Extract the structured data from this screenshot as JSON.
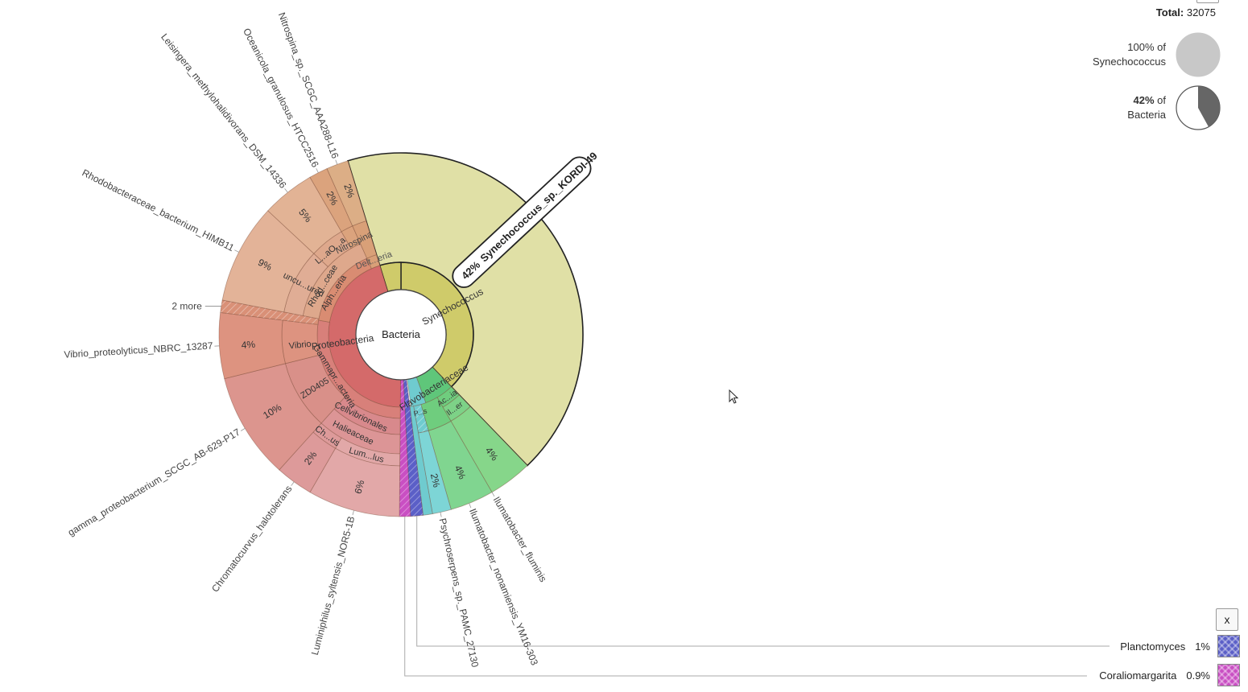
{
  "header": {
    "total_label": "Total:",
    "total_value": "32075"
  },
  "pies": [
    {
      "pct": "100%",
      "of": "of",
      "name": "Synechococcus",
      "fraction": 1.0
    },
    {
      "pct": "42%",
      "of": "of",
      "name": "Bacteria",
      "fraction": 0.42
    }
  ],
  "details_close_label": "x",
  "legend": [
    {
      "name": "Planctomyces",
      "pct": "1%",
      "color": "#5b5fc7"
    },
    {
      "name": "Coraliomargarita",
      "pct": "0.9%",
      "color": "#c94fc3"
    }
  ],
  "chart_data": {
    "type": "krona-sunburst",
    "root": "Bacteria",
    "total": 32075,
    "selected": "Synechococcus_sp._KORDI-49",
    "rank1": [
      {
        "name": "Proteobacteria",
        "label": "Proteobacteria",
        "color": "#d46a6a"
      },
      {
        "name": "Synechococcus",
        "label": "Synechococcus",
        "color": "#cfcb6a"
      },
      {
        "name": "Flavobacteriaceae",
        "label": "Flavobacteriaceae",
        "color": "#5fc67a"
      },
      {
        "name": "Planctomyces",
        "label": "",
        "color": "#5b5fc7"
      },
      {
        "name": "Coraliomargarita",
        "label": "",
        "color": "#c94fc3"
      }
    ],
    "rank2": [
      {
        "name": "Alphaproteobacteria",
        "label": "Alph...eria"
      },
      {
        "name": "Deltaproteobacteria",
        "label": "Delt...eria"
      },
      {
        "name": "Gammaproteobacteria",
        "label": "Gammapr...acteria"
      },
      {
        "name": "Acidimicrobiia",
        "label": "Ac...ia"
      },
      {
        "name": "Psychroserpens",
        "label": "P...s"
      }
    ],
    "rank3": [
      {
        "name": "Rhodobacteraceae",
        "label": "Rhod...ceae"
      },
      {
        "name": "Nitrospina",
        "label": "Nitrospina"
      },
      {
        "name": "Vibrio",
        "label": "Vibrio"
      },
      {
        "name": "ZD0405",
        "label": "ZD0405"
      },
      {
        "name": "Cellvibrionales",
        "label": "Cellvibrionales"
      },
      {
        "name": "Halieaceae",
        "label": "Halieaceae"
      },
      {
        "name": "Ilumatobacter",
        "label": "Il...er"
      }
    ],
    "rank4": [
      {
        "name": "uncultured",
        "label": "uncu...ured"
      },
      {
        "name": "L...aO...a",
        "label": "L...aO...a"
      },
      {
        "name": "Chromatocurvus",
        "label": "Ch...us"
      },
      {
        "name": "Luminiphilus",
        "label": "Lum...lus"
      }
    ],
    "species": [
      {
        "name": "Synechococcus_sp._KORDI-49",
        "pct": "42%"
      },
      {
        "name": "Ilumatobacter_fluminis",
        "pct": "4%"
      },
      {
        "name": "Ilumatobacter_nonamiensis_YM16-303",
        "pct": "4%"
      },
      {
        "name": "Psychroserpens_sp._PAMC_27130",
        "pct": "2%"
      },
      {
        "name": "Planctomyces",
        "pct": "1%"
      },
      {
        "name": "Coraliomargarita",
        "pct": "0.9%"
      },
      {
        "name": "Luminiphilus_syltensis_NOR5-1B",
        "pct": "6%"
      },
      {
        "name": "Chromatocurvus_halotolerans",
        "pct": "2%"
      },
      {
        "name": "gamma_proteobacterium_SCGC_AB-629-P17",
        "pct": "10%"
      },
      {
        "name": "Vibrio_proteolyticus_NBRC_13287",
        "pct": "4%"
      },
      {
        "name": "2 more",
        "pct": ""
      },
      {
        "name": "Rhodobacteraceae_bacterium_HIMB11",
        "pct": "9%"
      },
      {
        "name": "Leisingera_methylohalidivorans_DSM_14336",
        "pct": "5%"
      },
      {
        "name": "Oceanicola_granulosus_HTCC2516",
        "pct": "2%"
      },
      {
        "name": "Nitrospina_sp._SCGC_AAA288-L16",
        "pct": "2%"
      }
    ]
  }
}
